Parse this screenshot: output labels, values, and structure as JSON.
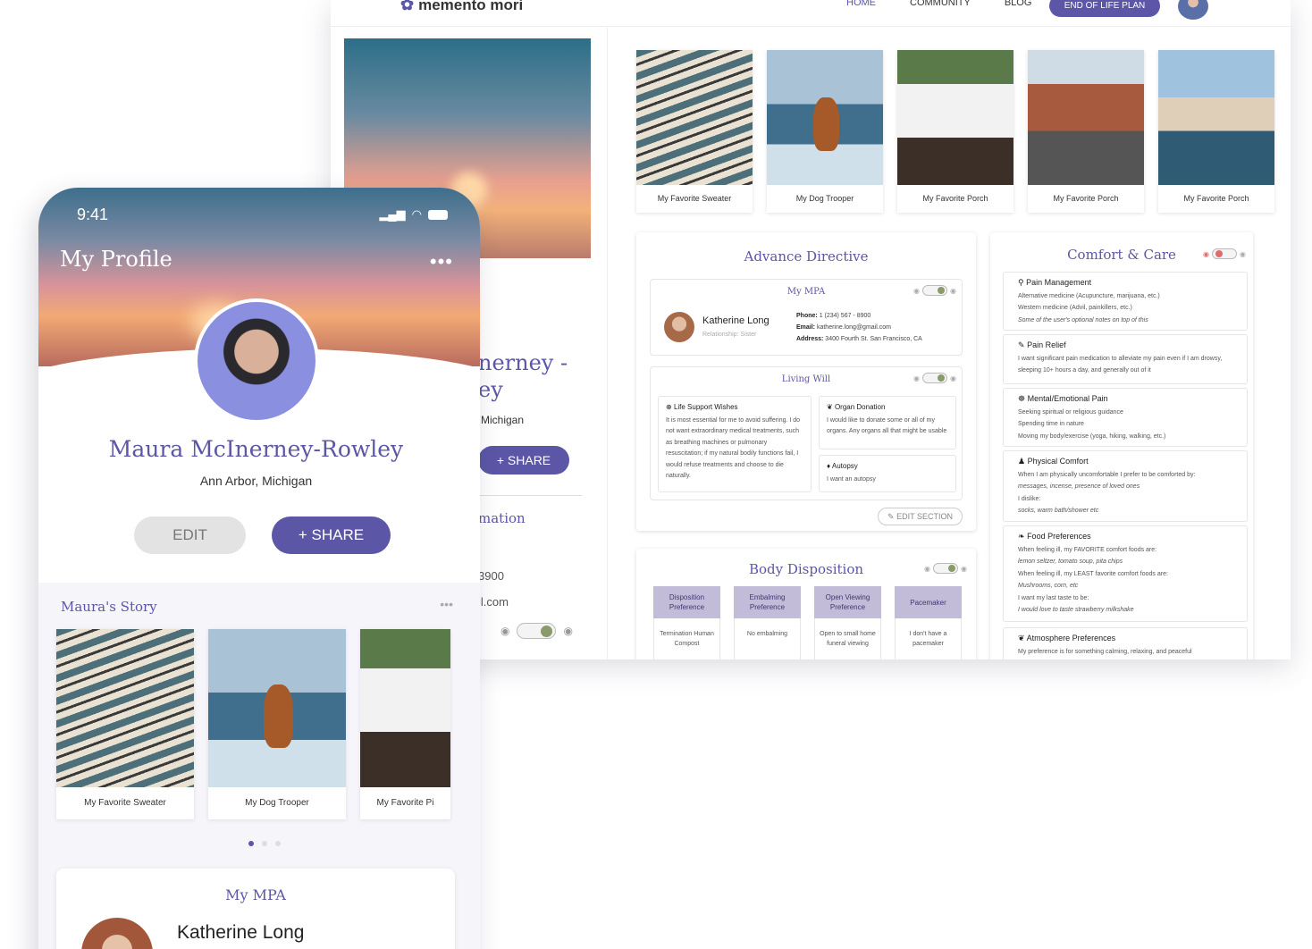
{
  "desktop": {
    "logo": "memento mori",
    "nav": {
      "home": "HOME",
      "community": "COMMUNITY",
      "blog": "BLOG",
      "eol": "END OF LIFE PLAN"
    },
    "left": {
      "name_partial": "nerney -\ney",
      "location_partial": "Michigan",
      "share": "+ SHARE",
      "info_title_partial": "mation",
      "phone_partial": "3900",
      "email_partial": "il.com"
    },
    "photos": [
      {
        "caption": "My Favorite Sweater",
        "kind": "sweater"
      },
      {
        "caption": "My Dog Trooper",
        "kind": "dog"
      },
      {
        "caption": "My Favorite Porch",
        "kind": "porch"
      },
      {
        "caption": "My Favorite Porch",
        "kind": "road"
      },
      {
        "caption": "My Favorite Porch",
        "kind": "venice"
      }
    ],
    "advance_directive": {
      "title": "Advance Directive",
      "mpa": {
        "title": "My MPA",
        "name": "Katherine Long",
        "relationship": "Relationship: Sister",
        "phone_label": "Phone:",
        "phone": "1 (234) 567 - 8900",
        "email_label": "Email:",
        "email": "katherine.long@gmail.com",
        "address_label": "Address:",
        "address": "3400 Fourth St. San Francisco, CA"
      },
      "living_will": {
        "title": "Living Will",
        "life_support_title": "Life Support Wishes",
        "life_support_text": "It is most essential for me to avoid suffering. I do not want extraordinary medical treatments, such as breathing machines or pulmonary resuscitation; if my natural bodily functions fail, I would refuse treatments and choose to die naturally.",
        "organ_title": "Organ Donation",
        "organ_text": "I would like to donate some or all of my organs. Any organs all that might be usable",
        "autopsy_title": "Autopsy",
        "autopsy_text": "I want an autopsy"
      },
      "edit_section": "EDIT SECTION"
    },
    "body_disposition": {
      "title": "Body Disposition",
      "columns": [
        {
          "head": "Disposition Preference",
          "body": "Termination Human Compost"
        },
        {
          "head": "Embalming Preference",
          "body": "No embalming"
        },
        {
          "head": "Open Viewing Preference",
          "body": "Open to small home funeral viewing"
        },
        {
          "head": "Pacemaker",
          "body": "I don't have a pacemaker"
        }
      ]
    },
    "comfort_care": {
      "title": "Comfort & Care",
      "pain_mgmt_title": "Pain Management",
      "pain_mgmt_l1": "Alternative medicine (Acupuncture, marijuana, etc.)",
      "pain_mgmt_l2": "Western medicine (Advil, painkillers, etc.)",
      "pain_mgmt_l3": "Some of the user's optional notes on top of this",
      "pain_relief_title": "Pain Relief",
      "pain_relief_text": "I want significant pain medication to alleviate my pain even if I am drowsy, sleeping 10+ hours a day, and generally out of it",
      "mental_title": "Mental/Emotional Pain",
      "mental_l1": "Seeking spiritual or religious guidance",
      "mental_l2": "Spending time in nature",
      "mental_l3": "Moving my body/exercise (yoga, hiking, walking, etc.)",
      "physical_title": "Physical Comfort",
      "physical_l1": "When I am physically uncomfortable I prefer to be comforted by:",
      "physical_l2": "messages, incense, presence of loved ones",
      "physical_l3": "I dislike:",
      "physical_l4": "socks, warm bath/shower etc",
      "food_title": "Food Preferences",
      "food_l1": "When feeling ill, my FAVORITE comfort foods are:",
      "food_l2": "lemon seltzer, tomato soup, pita chips",
      "food_l3": "When feeling ill, my LEAST favorite comfort foods are:",
      "food_l4": "Mushrooms, corn, etc",
      "food_l5": "I want my last taste to be:",
      "food_l6": "I would love to taste strawberry milkshake",
      "atmosphere_title": "Atmosphere Preferences",
      "atmosphere_text": "My preference is for something calming, relaxing, and peaceful"
    }
  },
  "phone": {
    "time": "9:41",
    "title": "My Profile",
    "more": "•••",
    "name": "Maura McInerney-Rowley",
    "location": "Ann Arbor, Michigan",
    "edit": "EDIT",
    "share": "+ SHARE",
    "story_title": "Maura's Story",
    "story_more": "•••",
    "photos": [
      {
        "caption": "My Favorite Sweater",
        "kind": "sweater"
      },
      {
        "caption": "My Dog Trooper",
        "kind": "dog"
      },
      {
        "caption": "My Favorite Pi",
        "kind": "porch"
      }
    ],
    "mpa_title": "My MPA",
    "mpa_name": "Katherine Long"
  },
  "colors": {
    "accent": "#5b56a6",
    "toggle_on": "#8a9a6a",
    "toggle_off": "#e06b6b"
  }
}
